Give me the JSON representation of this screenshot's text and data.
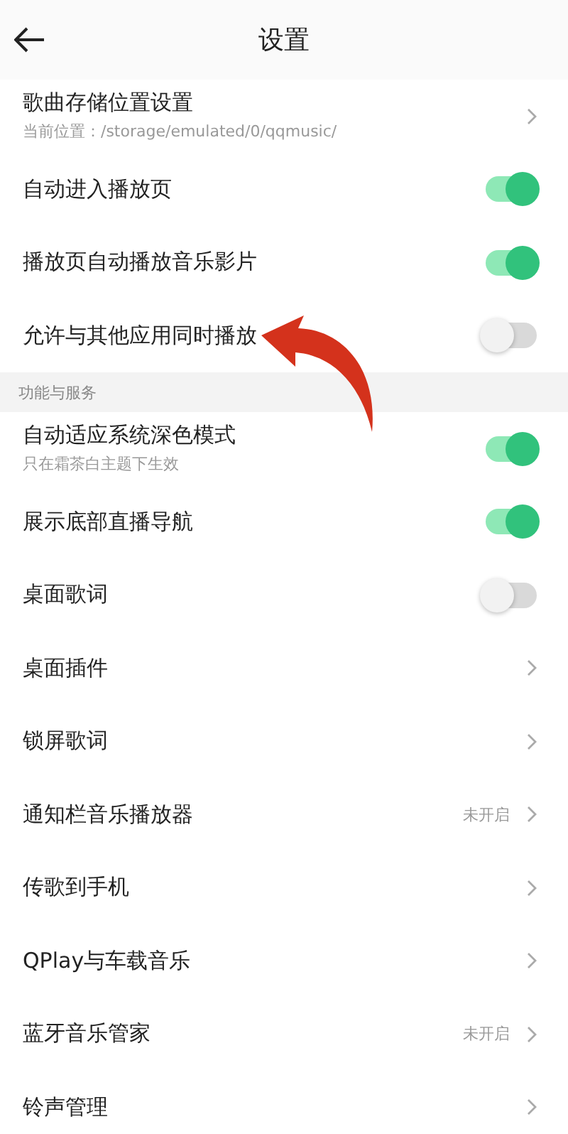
{
  "header": {
    "title": "设置"
  },
  "sections": [
    {
      "items": [
        {
          "kind": "nav",
          "label": "歌曲存储位置设置",
          "subtitle": "当前位置：/storage/emulated/0/qqmusic/"
        },
        {
          "kind": "toggle",
          "label": "自动进入播放页",
          "on": true
        },
        {
          "kind": "toggle",
          "label": "播放页自动播放音乐影片",
          "on": true
        },
        {
          "kind": "toggle",
          "label": "允许与其他应用同时播放",
          "on": false
        }
      ]
    },
    {
      "title": "功能与服务",
      "items": [
        {
          "kind": "toggle",
          "label": "自动适应系统深色模式",
          "subtitle": "只在霜茶白主题下生效",
          "on": true
        },
        {
          "kind": "toggle",
          "label": "展示底部直播导航",
          "on": true
        },
        {
          "kind": "toggle",
          "label": "桌面歌词",
          "on": false
        },
        {
          "kind": "nav",
          "label": "桌面插件"
        },
        {
          "kind": "nav",
          "label": "锁屏歌词"
        },
        {
          "kind": "nav",
          "label": "通知栏音乐播放器",
          "value": "未开启"
        },
        {
          "kind": "nav",
          "label": "传歌到手机"
        },
        {
          "kind": "nav",
          "label": "QPlay与车载音乐"
        },
        {
          "kind": "nav",
          "label": "蓝牙音乐管家",
          "value": "未开启"
        },
        {
          "kind": "nav",
          "label": "铃声管理"
        }
      ]
    }
  ]
}
